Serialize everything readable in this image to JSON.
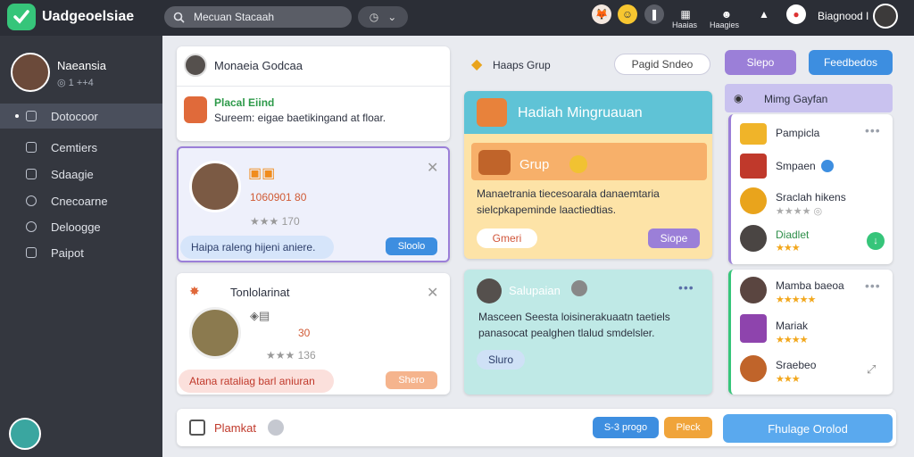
{
  "app": {
    "title": "Uadgeoelsiae"
  },
  "topbar": {
    "search_value": "Mecuan Stacaah",
    "icon_labels": [
      "Haaias",
      "Haagies"
    ],
    "username": "Biagnood I"
  },
  "sidebar": {
    "user_name": "Naeansia",
    "user_stat": "◎ 1 ++4",
    "items": [
      {
        "label": "Dotocoor",
        "icon": "home-icon",
        "active": true
      },
      {
        "label": "Cemtiers",
        "icon": "tag-icon",
        "active": false
      },
      {
        "label": "Sdaagie",
        "icon": "grid-icon",
        "active": false
      },
      {
        "label": "Cnecoarne",
        "icon": "info-icon",
        "active": false
      },
      {
        "label": "Deloogge",
        "icon": "chat-icon",
        "active": false
      },
      {
        "label": "Paipot",
        "icon": "page-icon",
        "active": false
      }
    ]
  },
  "feed": {
    "header_title": "Monaeia Godcaa",
    "post": {
      "author": "Placal Eiind",
      "text": "Sureem: eigae baetikingand at floar."
    },
    "card1": {
      "score": "1060901 80",
      "rating_text": "★★★ 170",
      "caption": "Haipa raleng hijeni aniere.",
      "button": "Sloolo"
    },
    "card2": {
      "title": "Tonlolarinat",
      "score": "30",
      "rating_text": "★★★ 136",
      "caption": "Atana rataliag barl aniuran",
      "button": "Shero"
    }
  },
  "middle": {
    "group_label": "Haaps Grup",
    "filter_button": "Pagid Sndeo",
    "banner_title": "Hadiah Mingruauan",
    "group_title": "Grup",
    "group_text": "Manaetrania tiecesoarala danaemtaria sielcpkapeminde laactiedtias.",
    "group_btn_left": "Gmeri",
    "group_btn_right": "Siope",
    "info_title": "Salupaian",
    "info_text": "Masceen Seesta loisinerakuaatn taetiels panasocat pealghen tlalud smdelsler.",
    "info_button": "Sluro",
    "info_more": "•••"
  },
  "right": {
    "btn_primary": "Slepo",
    "btn_secondary": "Feedbedos",
    "panel_title": "Mimg Gayfan",
    "items_top": [
      {
        "name": "Pampicla"
      },
      {
        "name": "Smpaen"
      },
      {
        "name": "Sraclah hikens",
        "sub": "★★★★ ◎"
      },
      {
        "name": "Diadlet"
      }
    ],
    "items_bottom": [
      {
        "name": "Mamba baeoa"
      },
      {
        "name": "Mariak"
      },
      {
        "name": "Sraebeo"
      }
    ]
  },
  "bottombar": {
    "label": "Plamkat",
    "btn1": "S-3 progo",
    "btn2": "Pleck",
    "btn3": "Fhulage Orolod"
  },
  "colors": {
    "accent_green": "#36c57a",
    "accent_blue": "#3d8ee0",
    "accent_orange": "#f0a43a",
    "accent_purple": "#9b7fd8",
    "sidebar_bg": "#34373f",
    "topbar_bg": "#2b2e36"
  }
}
